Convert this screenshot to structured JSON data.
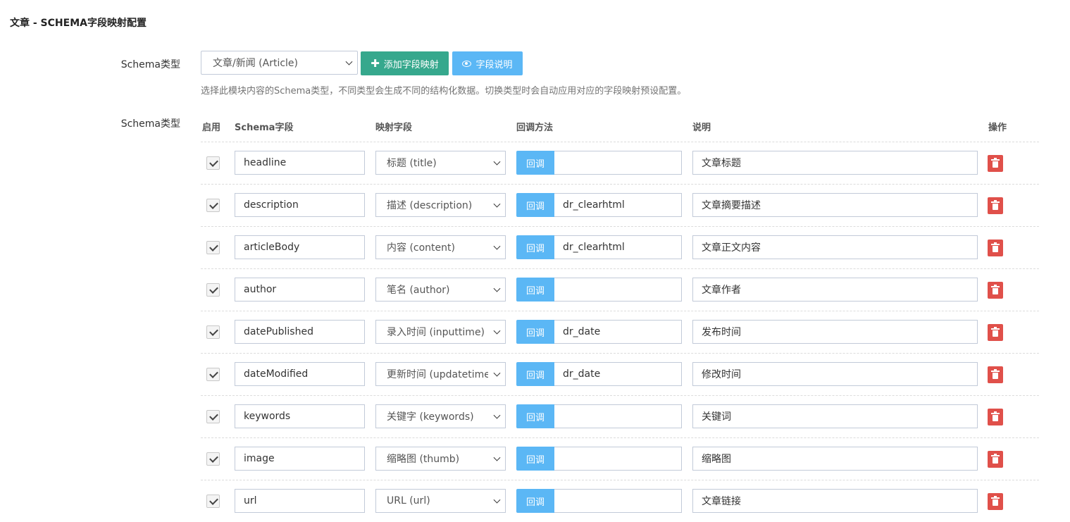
{
  "page": {
    "title": "文章 - SCHEMA字段映射配置"
  },
  "schema_type": {
    "label": "Schema类型",
    "selected": "文章/新闻 (Article)",
    "add_button": "添加字段映射",
    "help_button": "字段说明",
    "help_text": "选择此模块内容的Schema类型，不同类型会生成不同的结构化数据。切换类型时会自动应用对应的字段映射预设配置。"
  },
  "fields_section": {
    "label": "Schema类型",
    "headers": {
      "enable": "启用",
      "schema_field": "Schema字段",
      "mapped_field": "映射字段",
      "callback": "回调方法",
      "description": "说明",
      "action": "操作"
    },
    "callback_button": "回调",
    "rows": [
      {
        "enabled": true,
        "schema_field": "headline",
        "mapped": "标题 (title)",
        "callback": "",
        "description": "文章标题"
      },
      {
        "enabled": true,
        "schema_field": "description",
        "mapped": "描述 (description)",
        "callback": "dr_clearhtml",
        "description": "文章摘要描述"
      },
      {
        "enabled": true,
        "schema_field": "articleBody",
        "mapped": "内容 (content)",
        "callback": "dr_clearhtml",
        "description": "文章正文内容"
      },
      {
        "enabled": true,
        "schema_field": "author",
        "mapped": "笔名 (author)",
        "callback": "",
        "description": "文章作者"
      },
      {
        "enabled": true,
        "schema_field": "datePublished",
        "mapped": "录入时间 (inputtime)",
        "callback": "dr_date",
        "description": "发布时间"
      },
      {
        "enabled": true,
        "schema_field": "dateModified",
        "mapped": "更新时间 (updatetime)",
        "callback": "dr_date",
        "description": "修改时间"
      },
      {
        "enabled": true,
        "schema_field": "keywords",
        "mapped": "关键字 (keywords)",
        "callback": "",
        "description": "关键词"
      },
      {
        "enabled": true,
        "schema_field": "image",
        "mapped": "缩略图 (thumb)",
        "callback": "",
        "description": "缩略图"
      },
      {
        "enabled": true,
        "schema_field": "url",
        "mapped": "URL (url)",
        "callback": "",
        "description": "文章链接"
      }
    ]
  },
  "colors": {
    "add_button": "#36a88d",
    "info_button": "#5bb7f5",
    "delete_button": "#e0504a"
  }
}
